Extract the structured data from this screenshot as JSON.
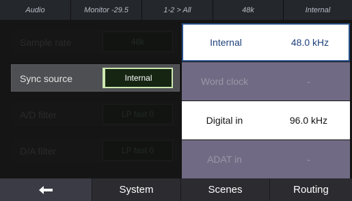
{
  "status_bar": [
    {
      "text": "Audio"
    },
    {
      "text": "Monitor -29.5"
    },
    {
      "text": "1-2 > All"
    },
    {
      "text": "48k"
    },
    {
      "text": "Internal"
    }
  ],
  "settings": [
    {
      "label": "Sample rate",
      "value": "48k"
    },
    {
      "label": "Sync source",
      "value": "Internal"
    },
    {
      "label": "A/D filter",
      "value": "LP fast 0"
    },
    {
      "label": "D/A filter",
      "value": "LP fast 0"
    }
  ],
  "dropdown": {
    "options": [
      {
        "label": "Internal",
        "rate": "48.0 kHz"
      },
      {
        "label": "Word clock",
        "rate": "-"
      },
      {
        "label": "Digital in",
        "rate": "96.0 kHz"
      },
      {
        "label": "ADAT in",
        "rate": "-"
      }
    ]
  },
  "nav": {
    "back_icon": "back-arrow-icon",
    "tabs": [
      {
        "label": "System"
      },
      {
        "label": "Scenes"
      },
      {
        "label": "Routing"
      }
    ]
  }
}
